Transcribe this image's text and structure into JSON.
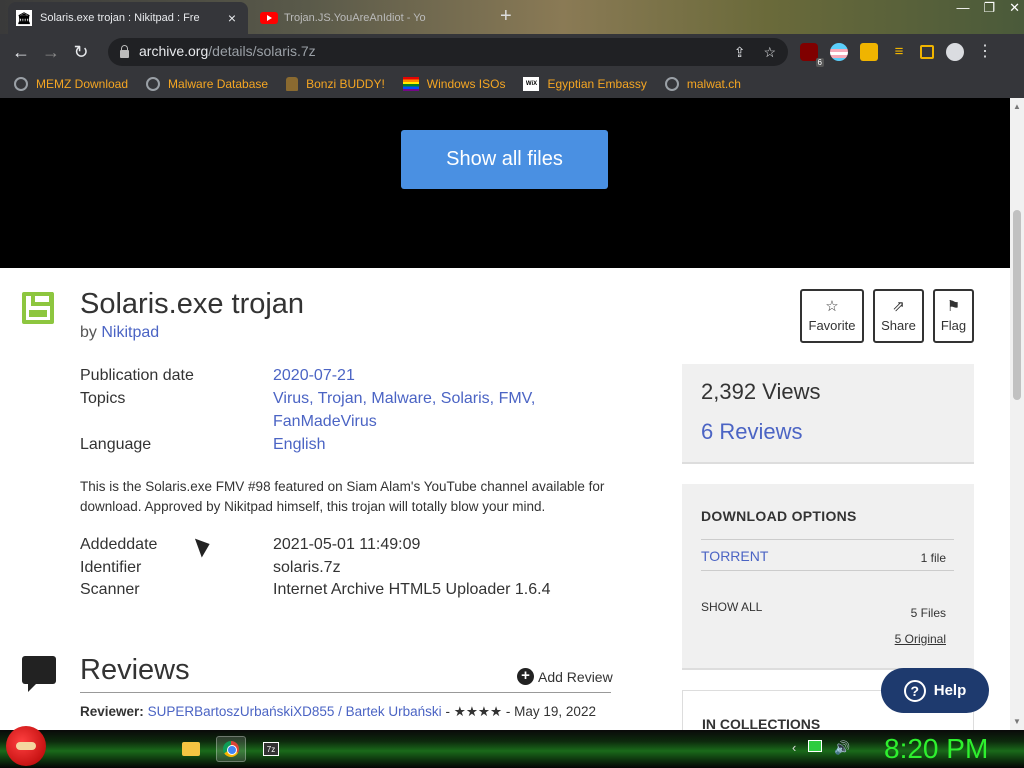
{
  "browser": {
    "active_tab_title": "Solaris.exe trojan : Nikitpad : Fre",
    "active_tab_icon": "internet-archive-icon",
    "inactive_tab_title": "Trojan.JS.YouAreAnIdiot - Yo",
    "url_host": "archive.org",
    "url_path": "/details/solaris.7z",
    "ublock_count": "6"
  },
  "bookmarks": [
    {
      "label": "MEMZ Download",
      "icon": "globe-icon"
    },
    {
      "label": "Malware Database",
      "icon": "globe-icon"
    },
    {
      "label": "Bonzi BUDDY!",
      "icon": "bonzi-icon"
    },
    {
      "label": "Windows ISOs",
      "icon": "rainbow-flag-icon"
    },
    {
      "label": "Egyptian Embassy",
      "icon": "wix-icon"
    },
    {
      "label": "malwat.ch",
      "icon": "globe-icon"
    }
  ],
  "hero": {
    "show_all_files": "Show all files"
  },
  "item": {
    "title": "Solaris.exe trojan",
    "by_prefix": "by",
    "author": "Nikitpad"
  },
  "actions": {
    "favorite": "Favorite",
    "share": "Share",
    "flag": "Flag"
  },
  "metadata": {
    "publication_date_key": "Publication date",
    "publication_date_val": "2020-07-21",
    "topics_key": "Topics",
    "topics_val_line1": "Virus, Trojan, Malware, Solaris, FMV,",
    "topics_val_line2": "FanMadeVirus",
    "language_key": "Language",
    "language_val": "English"
  },
  "description": "This is the Solaris.exe FMV #98 featured on Siam Alam's YouTube channel available for download. Approved by Nikitpad himself, this trojan will totally blow your mind.",
  "metadata2": {
    "addeddate_key": "Addeddate",
    "addeddate_val": "2021-05-01 11:49:09",
    "identifier_key": "Identifier",
    "identifier_val": "solaris.7z",
    "scanner_key": "Scanner",
    "scanner_val": "Internet Archive HTML5 Uploader 1.6.4"
  },
  "stats": {
    "views": "2,392 Views",
    "reviews": "6 Reviews"
  },
  "download_options": {
    "heading": "DOWNLOAD OPTIONS",
    "torrent": "TORRENT",
    "torrent_count": "1 file",
    "show_all": "SHOW ALL",
    "files_count": "5 Files",
    "original_count": "5 Original"
  },
  "collections": {
    "heading": "IN COLLECTIONS"
  },
  "reviews": {
    "heading": "Reviews",
    "add_review": "Add Review",
    "reviewer_label": "Reviewer:",
    "reviewer_name": "SUPERBartoszUrbańskiXD855 / Bartek Urbański",
    "stars": "★★★★",
    "date": "- May 19, 2022"
  },
  "help": {
    "label": "Help"
  },
  "taskbar": {
    "clock": "8:20 PM",
    "sevenzip_label": "7z"
  },
  "colors": {
    "accent_blue": "#4a90e2",
    "link": "#4b64c4",
    "clock_green": "#2ef02e",
    "floppy_green": "#8dc63f"
  }
}
